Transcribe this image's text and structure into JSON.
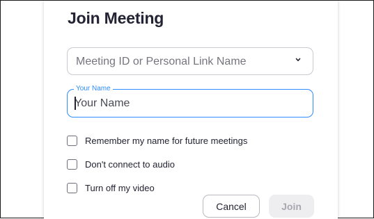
{
  "dialog": {
    "title": "Join Meeting",
    "meeting_select": {
      "placeholder": "Meeting ID or Personal Link Name",
      "chevron_icon": "chevron-down-icon"
    },
    "name_field": {
      "legend": "Your Name",
      "placeholder": "Your Name",
      "value": ""
    },
    "options": [
      {
        "label": "Remember my name for future meetings",
        "checked": false
      },
      {
        "label": "Don't connect to audio",
        "checked": false
      },
      {
        "label": "Turn off my video",
        "checked": false
      }
    ],
    "buttons": {
      "cancel_label": "Cancel",
      "join_label": "Join"
    }
  },
  "colors": {
    "accent": "#2d8cff",
    "title_text": "#232333",
    "join_disabled_bg": "#eeeef1",
    "join_disabled_text": "#a8a8b0"
  }
}
